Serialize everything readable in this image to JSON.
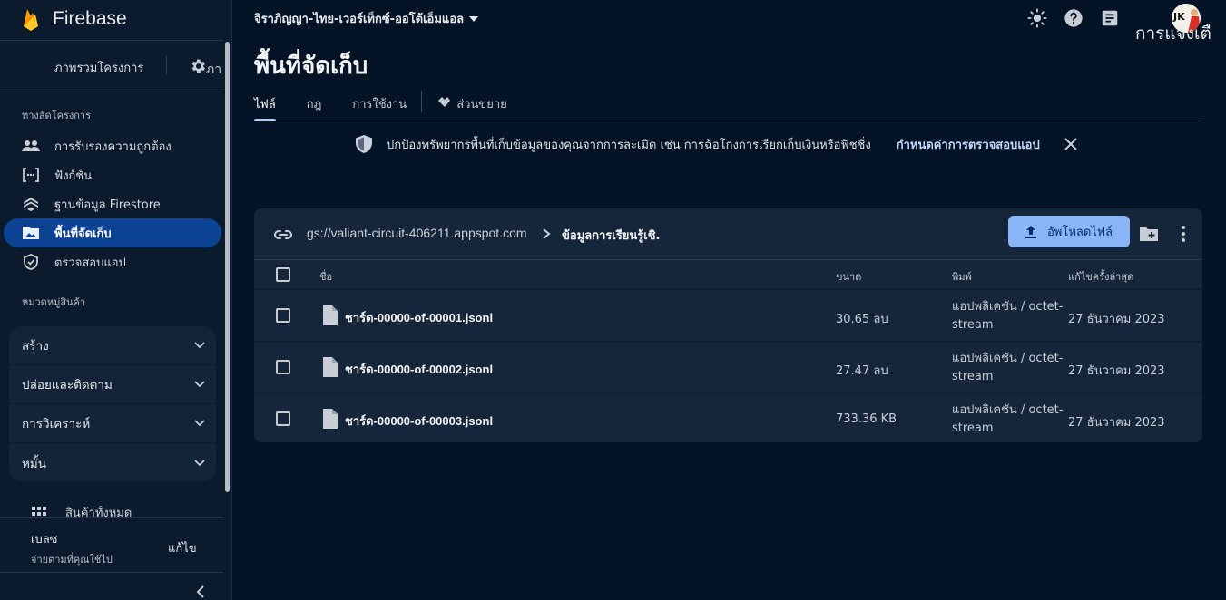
{
  "brand": {
    "name": "Firebase"
  },
  "sidebar": {
    "overview": "ภาพรวมโครงการ",
    "overview_more": "ภา",
    "shortcuts_label": "ทางลัดโครงการ",
    "items": [
      {
        "label": "การรับรองความถูกต้อง",
        "icon": "users-icon"
      },
      {
        "label": "ฟังก์ชัน",
        "icon": "functions-icon"
      },
      {
        "label": "ฐานข้อมูล Firestore",
        "icon": "firestore-icon"
      },
      {
        "label": "พื้นที่จัดเก็บ",
        "icon": "storage-icon",
        "active": true
      },
      {
        "label": "ตรวจสอบแอป",
        "icon": "app-check-icon"
      }
    ],
    "categories_label": "หมวดหมู่สินค้า",
    "groups": [
      "สร้าง",
      "ปล่อยและติดตาม",
      "การวิเคราะห์",
      "หมั้น"
    ],
    "all_products": "สินค้าทั้งหมด",
    "plan": {
      "name": "เบลซ",
      "subtitle": "จ่ายตามที่คุณใช้ไป",
      "edit": "แก้ไข"
    }
  },
  "topbar": {
    "project": "จิราภิญญา-ไทย-เวอร์เท็กซ์-ออโต้เอ็มแอล",
    "right_text": "การแจ้งเตื",
    "avatar_initials": "JK"
  },
  "page": {
    "title": "พื้นที่จัดเก็บ",
    "tabs": [
      "ไฟล์",
      "กฎ",
      "การใช้งาน",
      "ส่วนขยาย"
    ],
    "active_tab": 0
  },
  "banner": {
    "text": "ปกป้องทรัพยากรพื้นที่เก็บข้อมูลของคุณจากการละเมิด เช่น การฉ้อโกงการเรียกเก็บเงินหรือฟิชชิ่ง",
    "link": "กำหนดค่าการตรวจสอบแอป"
  },
  "files": {
    "bucket": "gs://valiant-circuit-406211.appspot.com",
    "folder": "ข้อมูลการเรียนรู้เชิ.",
    "upload_label": "อัพโหลดไฟล์",
    "columns": {
      "name": "ชื่อ",
      "size": "ขนาด",
      "type": "พิมพ์",
      "modified": "แก้ไขครั้งล่าสุด"
    },
    "rows": [
      {
        "name": "ชาร์ด-00000-of-00001.jsonl",
        "size": "30.65 ลบ",
        "type": "แอปพลิเคชัน / octet-stream",
        "modified": "27 ธันวาคม 2023"
      },
      {
        "name": "ชาร์ด-00000-of-00002.jsonl",
        "size": "27.47 ลบ",
        "type": "แอปพลิเคชัน / octet-stream",
        "modified": "27 ธันวาคม 2023"
      },
      {
        "name": "ชาร์ด-00000-of-00003.jsonl",
        "size": "733.36 KB",
        "type": "แอปพลิเคชัน / octet-stream",
        "modified": "27 ธันวาคม 2023"
      }
    ]
  },
  "colors": {
    "background": "#041325",
    "sidebar": "#0b1a2c",
    "accent": "#8ab4f8",
    "active_nav": "#0d4394",
    "card": "#16263a"
  }
}
